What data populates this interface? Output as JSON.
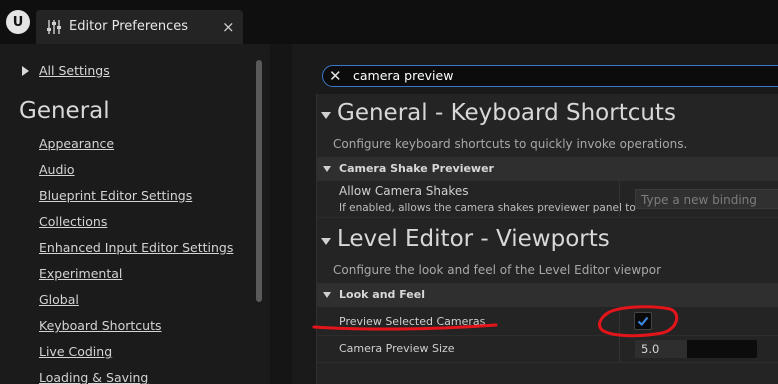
{
  "window": {
    "logo_text": "U",
    "tab_label": "Editor Preferences",
    "tab_close": "×"
  },
  "sidebar": {
    "all_settings": "All Settings",
    "section_title": "General",
    "items": [
      "Appearance",
      "Audio",
      "Blueprint Editor Settings",
      "Collections",
      "Enhanced Input Editor Settings",
      "Experimental",
      "Global",
      "Keyboard Shortcuts",
      "Live Coding",
      "Loading & Saving"
    ]
  },
  "search": {
    "clear_icon": "✕",
    "value": "camera preview"
  },
  "sections": {
    "keyboard": {
      "title": "General - Keyboard Shortcuts",
      "description": "Configure keyboard shortcuts to quickly invoke operations.",
      "category": "Camera Shake Previewer",
      "row_label": "Allow Camera Shakes",
      "row_description": "If enabled, allows the camera shakes previewer panel to",
      "binding_placeholder": "Type a new binding"
    },
    "viewports": {
      "title": "Level Editor - Viewports",
      "description": "Configure the look and feel of the Level Editor viewpor",
      "category": "Look and Feel",
      "preview_selected_label": "Preview Selected Cameras",
      "preview_selected_checked": true,
      "camera_preview_size_label": "Camera Preview Size",
      "camera_preview_size_value": "5.0",
      "camera_preview_size_fraction": 0.43
    }
  },
  "colors": {
    "accent_blue": "#3a78c9",
    "checkmark": "#3b8eea",
    "annotation_red": "#e4141b"
  }
}
